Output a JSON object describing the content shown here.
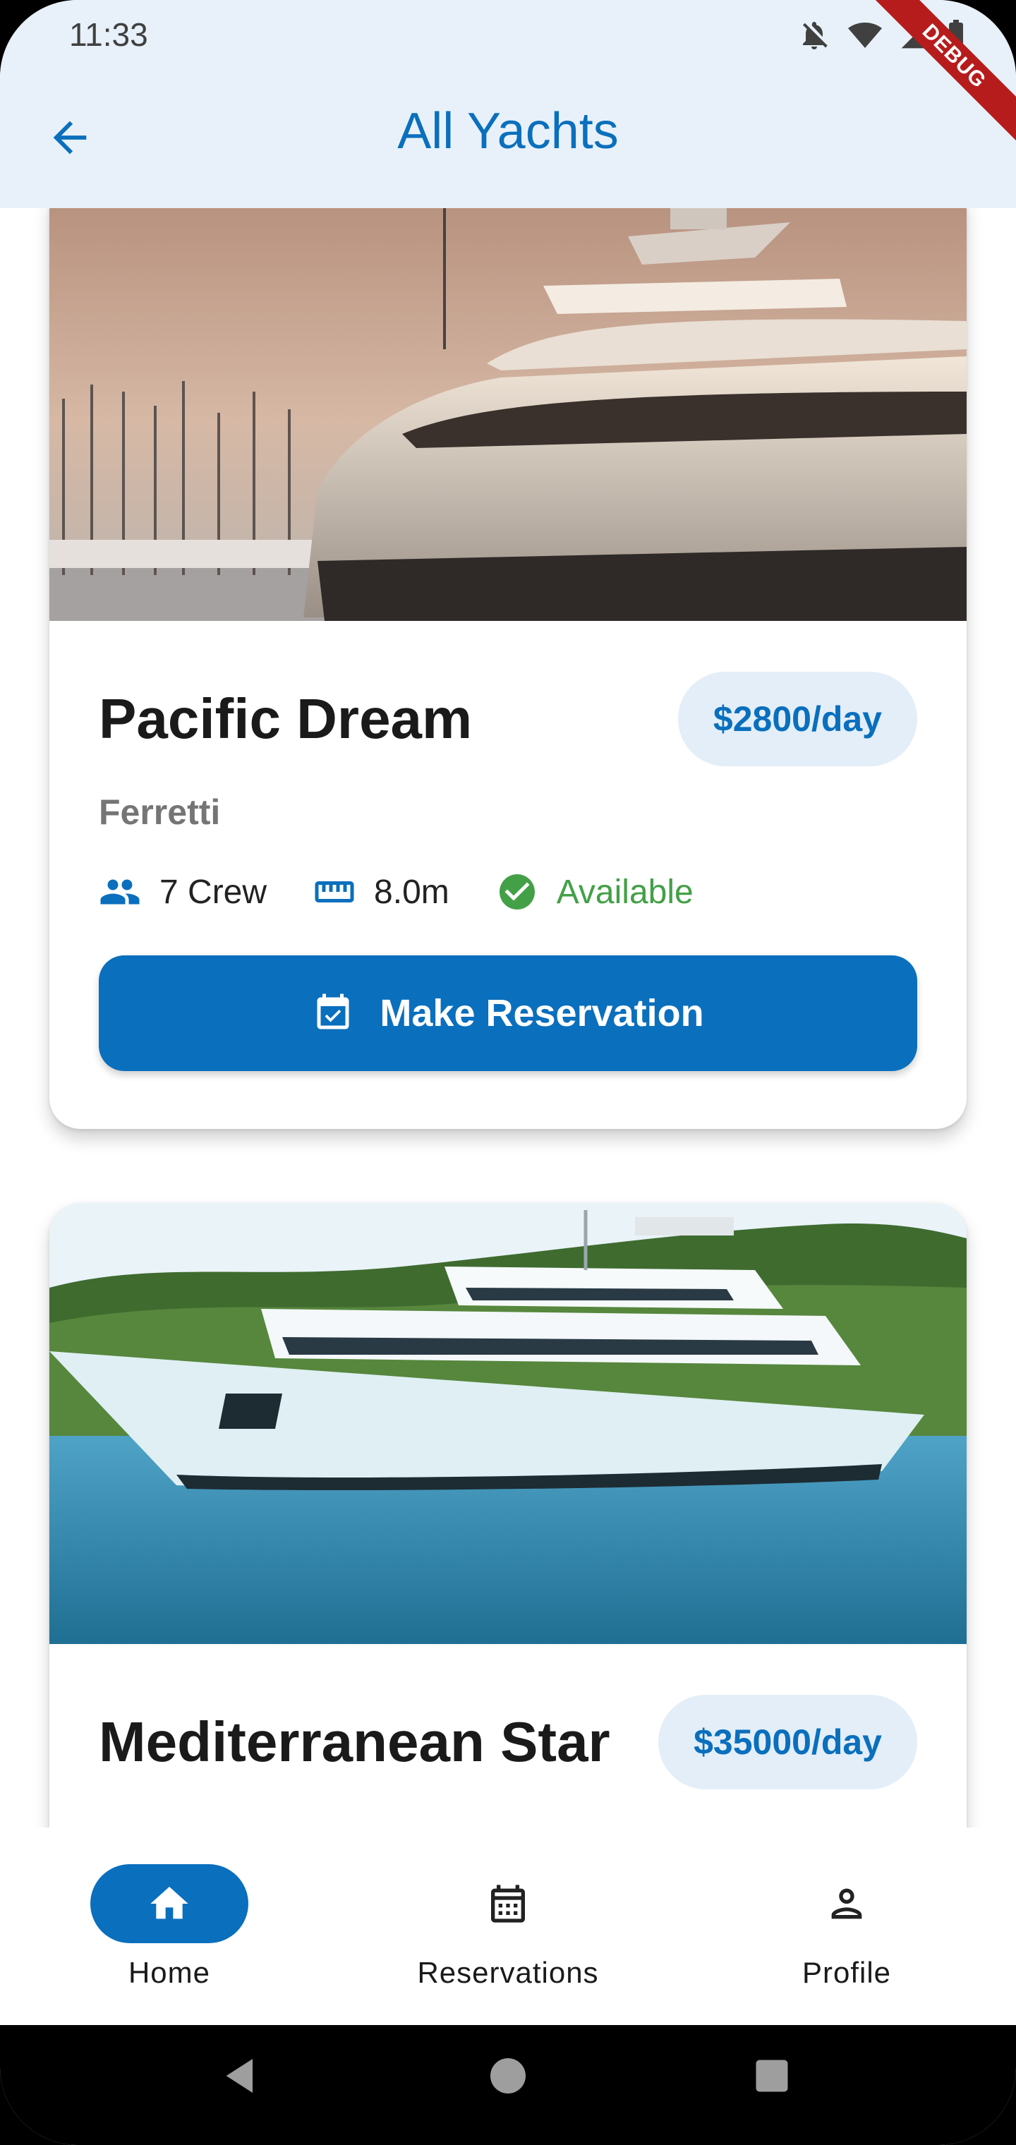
{
  "status_bar": {
    "time": "11:33",
    "icons": [
      "notifications-off-icon",
      "wifi-icon",
      "signal-icon",
      "battery-icon"
    ],
    "debug_banner": "DEBUG"
  },
  "app_bar": {
    "title": "All Yachts",
    "back_icon": "arrow-back-icon"
  },
  "yachts": [
    {
      "name": "Pacific Dream",
      "price": "$2800/day",
      "brand": "Ferretti",
      "crew": "7 Crew",
      "length": "8.0m",
      "status": "Available",
      "button": "Make Reservation"
    },
    {
      "name": "Mediterranean Star",
      "price": "$35000/day",
      "brand": ""
    }
  ],
  "bottom_nav": {
    "items": [
      {
        "label": "Home",
        "icon": "home-icon",
        "active": true
      },
      {
        "label": "Reservations",
        "icon": "calendar-icon",
        "active": false
      },
      {
        "label": "Profile",
        "icon": "person-icon",
        "active": false
      }
    ]
  },
  "colors": {
    "primary": "#0a6fbd",
    "app_bar_bg": "#e8f1f9",
    "price_pill_bg": "#e3eef8",
    "available": "#43a047",
    "debug": "#b71c1c"
  }
}
